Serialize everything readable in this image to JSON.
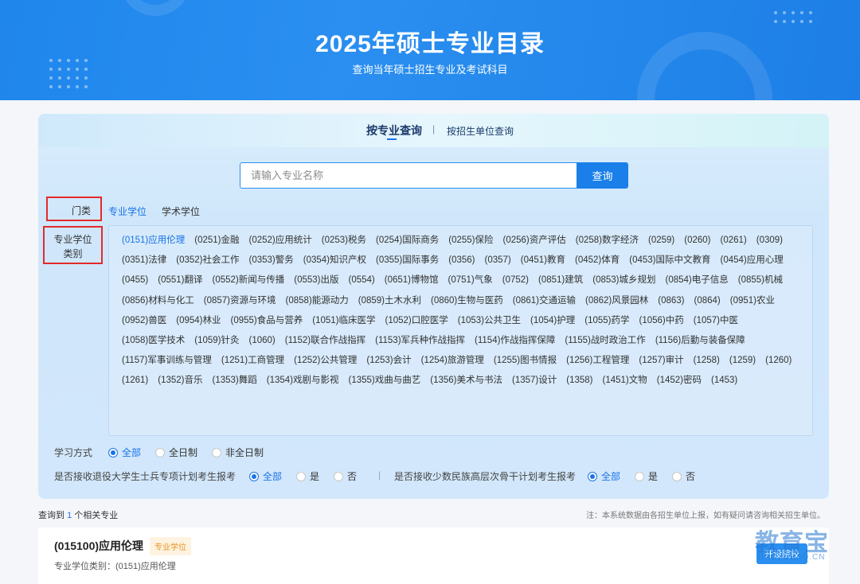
{
  "banner": {
    "title": "2025年硕士专业目录",
    "subtitle": "查询当年硕士招生专业及考试科目"
  },
  "tabs": {
    "by_major": "按专业查询",
    "separator": "|",
    "by_unit": "按招生单位查询"
  },
  "search": {
    "placeholder": "请输入专业名称",
    "value": "",
    "button": "查询"
  },
  "category": {
    "label": "门类",
    "professional": "专业学位",
    "academic": "学术学位",
    "selected": "专业学位"
  },
  "degree_type": {
    "label_line1": "专业学位",
    "label_line2": "类别",
    "items": [
      "(0151)应用伦理",
      "(0251)金融",
      "(0252)应用统计",
      "(0253)税务",
      "(0254)国际商务",
      "(0255)保险",
      "(0256)资产评估",
      "(0258)数字经济",
      "(0259)",
      "(0260)",
      "(0261)",
      "(0309)",
      "(0351)法律",
      "(0352)社会工作",
      "(0353)警务",
      "(0354)知识产权",
      "(0355)国际事务",
      "(0356)",
      "(0357)",
      "(0451)教育",
      "(0452)体育",
      "(0453)国际中文教育",
      "(0454)应用心理",
      "(0455)",
      "(0551)翻译",
      "(0552)新闻与传播",
      "(0553)出版",
      "(0554)",
      "(0651)博物馆",
      "(0751)气象",
      "(0752)",
      "(0851)建筑",
      "(0853)城乡规划",
      "(0854)电子信息",
      "(0855)机械",
      "(0856)材料与化工",
      "(0857)资源与环境",
      "(0858)能源动力",
      "(0859)土木水利",
      "(0860)生物与医药",
      "(0861)交通运输",
      "(0862)风景园林",
      "(0863)",
      "(0864)",
      "(0951)农业",
      "(0952)兽医",
      "(0954)林业",
      "(0955)食品与营养",
      "(1051)临床医学",
      "(1052)口腔医学",
      "(1053)公共卫生",
      "(1054)护理",
      "(1055)药学",
      "(1056)中药",
      "(1057)中医",
      "(1058)医学技术",
      "(1059)针灸",
      "(1060)",
      "(1152)联合作战指挥",
      "(1153)军兵种作战指挥",
      "(1154)作战指挥保障",
      "(1155)战时政治工作",
      "(1156)后勤与装备保障",
      "(1157)军事训练与管理",
      "(1251)工商管理",
      "(1252)公共管理",
      "(1253)会计",
      "(1254)旅游管理",
      "(1255)图书情报",
      "(1256)工程管理",
      "(1257)审计",
      "(1258)",
      "(1259)",
      "(1260)",
      "(1261)",
      "(1352)音乐",
      "(1353)舞蹈",
      "(1354)戏剧与影视",
      "(1355)戏曲与曲艺",
      "(1356)美术与书法",
      "(1357)设计",
      "(1358)",
      "(1451)文物",
      "(1452)密码",
      "(1453)"
    ],
    "selected": "(0151)应用伦理"
  },
  "study_mode": {
    "label": "学习方式",
    "options": [
      "全部",
      "全日制",
      "非全日制"
    ],
    "selected": "全部"
  },
  "veteran_plan": {
    "label": "是否接收退役大学生士兵专项计划考生报考",
    "options": [
      "全部",
      "是",
      "否"
    ],
    "selected": "全部"
  },
  "minority_plan": {
    "separator": "|",
    "label": "是否接收少数民族高层次骨干计划考生报考",
    "options": [
      "全部",
      "是",
      "否"
    ],
    "selected": "全部"
  },
  "results": {
    "prefix": "查询到",
    "count": "1",
    "suffix": "个相关专业",
    "note": "注：本系统数据由各招生单位上报，如有疑问请咨询相关招生单位。"
  },
  "result_item": {
    "title": "(015100)应用伦理",
    "badge": "专业学位",
    "subtitle": "专业学位类别：(0151)应用伦理",
    "button": "开设院校"
  },
  "watermark": {
    "main": "教育宝",
    "sub": "JIAOYUBAO.CN"
  },
  "colors": {
    "primary": "#1a73e8",
    "banner": "#2a8ff0",
    "highlight_box": "#e12b2b",
    "badge_text": "#e8962a"
  }
}
